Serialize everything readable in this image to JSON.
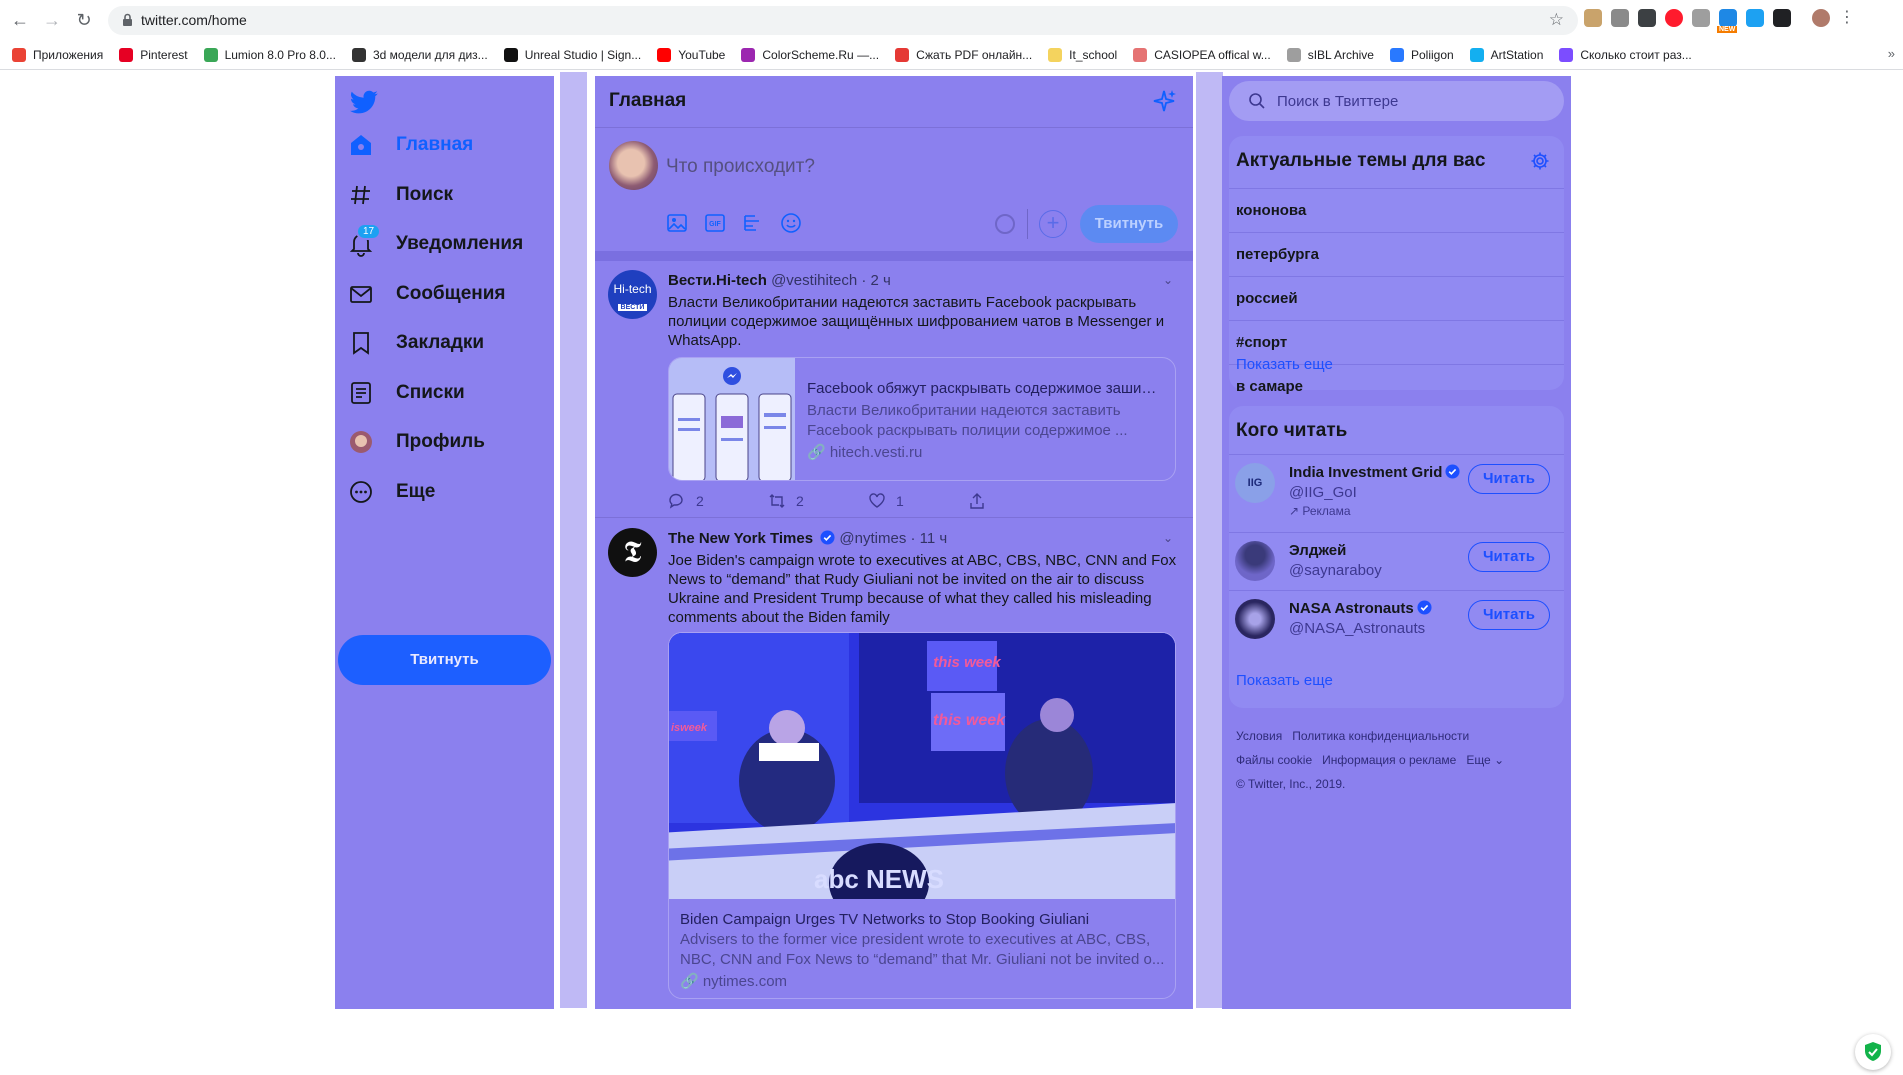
{
  "browser": {
    "url": "twitter.com/home",
    "bookmarks": [
      {
        "label": "Приложения",
        "color": "#ea4335"
      },
      {
        "label": "Pinterest",
        "color": "#e60023"
      },
      {
        "label": "Lumion 8.0 Pro 8.0...",
        "color": "#3aa757"
      },
      {
        "label": "3d модели для диз...",
        "color": "#333333"
      },
      {
        "label": "Unreal Studio | Sign...",
        "color": "#111111"
      },
      {
        "label": "YouTube",
        "color": "#ff0000"
      },
      {
        "label": "ColorScheme.Ru —...",
        "color": "#9c27b0"
      },
      {
        "label": "Сжать PDF онлайн...",
        "color": "#e53935"
      },
      {
        "label": "It_school",
        "color": "#f4d35e"
      },
      {
        "label": "CASIOPEA offical w...",
        "color": "#e57373"
      },
      {
        "label": "sIBL Archive",
        "color": "#9e9e9e"
      },
      {
        "label": "Poliigon",
        "color": "#2979ff"
      },
      {
        "label": "ArtStation",
        "color": "#13aff0"
      },
      {
        "label": "Сколько стоит раз...",
        "color": "#7c4dff"
      }
    ],
    "more_bookmarks": "»",
    "ext_new_badge": "NEW"
  },
  "nav": {
    "items": [
      {
        "label": "Главная",
        "icon": "home-icon"
      },
      {
        "label": "Поиск",
        "icon": "hashtag-icon"
      },
      {
        "label": "Уведомления",
        "icon": "bell-icon",
        "badge": "17"
      },
      {
        "label": "Сообщения",
        "icon": "envelope-icon"
      },
      {
        "label": "Закладки",
        "icon": "bookmark-icon"
      },
      {
        "label": "Списки",
        "icon": "list-icon"
      },
      {
        "label": "Профиль",
        "icon": "avatar-icon"
      },
      {
        "label": "Еще",
        "icon": "more-icon"
      }
    ],
    "tweet_button": "Твитнуть"
  },
  "home": {
    "title": "Главная",
    "compose_placeholder": "Что происходит?",
    "compose_send": "Твитнуть",
    "compose_plus": "+"
  },
  "tweets": [
    {
      "name": "Вести.Hi-tech",
      "handle": "@vestihitech",
      "time": "· 2 ч",
      "text": "Власти Великобритании надеются заставить Facebook раскрывать полиции содержимое защищённых шифрованием чатов в Messenger и WhatsApp.",
      "avatar_text": "Hi-tech",
      "avatar_sub": "ВЕСТИ",
      "card": {
        "title": "Facebook обяжут раскрывать содержимое зашифр...",
        "desc": "Власти Великобритании надеются заставить Facebook раскрывать полиции содержимое ...",
        "link": "🔗 hitech.vesti.ru"
      },
      "replies": "2",
      "retweets": "2",
      "likes": "1"
    },
    {
      "name": "The New York Times",
      "handle": "@nytimes",
      "time": "· 11 ч",
      "text": "Joe Biden's campaign wrote to executives at ABC, CBS, NBC, CNN and Fox News to “demand” that Rudy Giuliani not be invited on the air to discuss Ukraine and President Trump because of what they called his misleading comments about the Biden family",
      "avatar_text": "𝕿",
      "card": {
        "title": "Biden Campaign Urges TV Networks to Stop Booking Giuliani",
        "desc": "Advisers to the former vice president wrote to executives at ABC, CBS, NBC, CNN and Fox News to “demand” that Mr. Giuliani not be invited o...",
        "link": "🔗 nytimes.com",
        "photo_text_1": "this week",
        "photo_text_2": "this week",
        "photo_text_3": "isweek",
        "photo_logo": "abc NEWS"
      }
    }
  ],
  "right": {
    "search_placeholder": "Поиск в Твиттере",
    "trends_title": "Актуальные темы для вас",
    "trends": [
      "кононова",
      "петербурга",
      "россией",
      "#спорт",
      "в самаре"
    ],
    "show_more": "Показать еще",
    "who_title": "Кого читать",
    "who": [
      {
        "name": "India Investment Grid",
        "handle": "@IIG_GoI",
        "promo": "↗ Реклама",
        "avatar_text": "IIG"
      },
      {
        "name": "Элджей",
        "handle": "@saynaraboy"
      },
      {
        "name": "NASA Astronauts",
        "handle": "@NASA_Astronauts"
      }
    ],
    "follow_label": "Читать",
    "footer": [
      "Условия",
      "Политика конфиденциальности",
      "Файлы cookie",
      "Информация о рекламе",
      "Еще ⌄",
      "© Twitter, Inc., 2019."
    ]
  },
  "colors": {
    "accent": "#1d5fff",
    "overlay": "#8b80ee"
  }
}
